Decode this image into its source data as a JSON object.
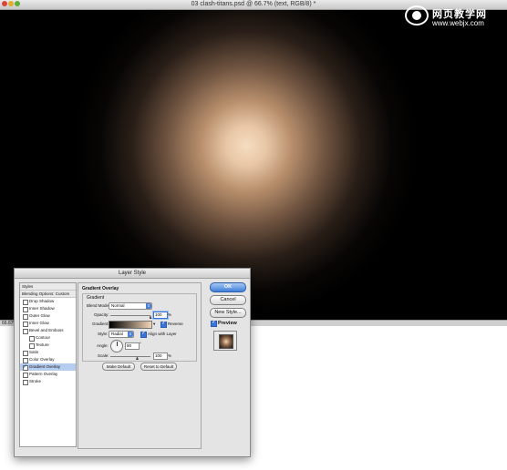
{
  "document": {
    "title": "03 clash-titans.psd @ 66.7% (text, RGB/8) *",
    "zoom": "66.67%"
  },
  "watermark": {
    "text": "网页教学网",
    "url": "www.webjx.com"
  },
  "dialog": {
    "title": "Layer Style",
    "styles_list": [
      {
        "label": "Styles",
        "kind": "header"
      },
      {
        "label": "Blending Options: Custom",
        "kind": "header"
      },
      {
        "label": "Drop Shadow",
        "checked": false
      },
      {
        "label": "Inner Shadow",
        "checked": false
      },
      {
        "label": "Outer Glow",
        "checked": false
      },
      {
        "label": "Inner Glow",
        "checked": false
      },
      {
        "label": "Bevel and Emboss",
        "checked": false
      },
      {
        "label": "Contour",
        "checked": false,
        "indent": true
      },
      {
        "label": "Texture",
        "checked": false,
        "indent": true
      },
      {
        "label": "Satin",
        "checked": false
      },
      {
        "label": "Color Overlay",
        "checked": false
      },
      {
        "label": "Gradient Overlay",
        "checked": true,
        "selected": true
      },
      {
        "label": "Pattern Overlay",
        "checked": false
      },
      {
        "label": "Stroke",
        "checked": false
      }
    ],
    "panel": {
      "section_title": "Gradient Overlay",
      "group_title": "Gradient",
      "blend_mode_label": "Blend Mode:",
      "blend_mode_value": "Normal",
      "opacity_label": "Opacity:",
      "opacity_value": "100",
      "opacity_unit": "%",
      "opacity_level": 1.0,
      "gradient_label": "Gradient:",
      "reverse_label": "Reverse",
      "reverse_checked": true,
      "style_label": "Style:",
      "style_value": "Radial",
      "align_label": "Align with Layer",
      "align_checked": true,
      "angle_label": "Angle:",
      "angle_value": "90",
      "angle_unit": "°",
      "scale_label": "Scale:",
      "scale_value": "100",
      "scale_unit": "%",
      "scale_level": 0.67,
      "make_default_label": "Make Default",
      "reset_default_label": "Reset to Default"
    },
    "buttons": {
      "ok": "OK",
      "cancel": "Cancel",
      "new_style": "New Style...",
      "preview": "Preview"
    }
  },
  "colors": {
    "accent": "#3a74d9",
    "selection": "#b5cdee",
    "glow": "#f6dcc0"
  }
}
